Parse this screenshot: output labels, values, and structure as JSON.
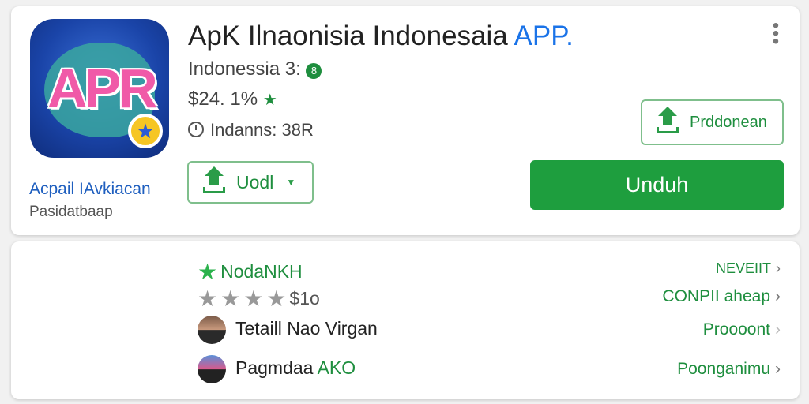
{
  "app": {
    "title_main": "ApK Ilnaonisia Indonesaia",
    "title_accent": "APP.",
    "meta_line1": "Indonessia 3:",
    "meta_line1_badge": "8",
    "meta_line2": "$24. 1%",
    "meta_line3": "Indanns: 38R",
    "icon_text": "APR",
    "icon_badge": "★",
    "developer": "Acpail IAvkiacan",
    "developer_sub": "Pasidatbaap"
  },
  "buttons": {
    "updl": "Uodl",
    "prd": "Prddonean",
    "unduh": "Unduh"
  },
  "rows": [
    {
      "label": "NodaNKH",
      "right": "NEVEIIT"
    },
    {
      "label": "$1o",
      "right": "CONPII aheap"
    },
    {
      "label": "Tetaill Nao Virgan",
      "right": "Proooont"
    },
    {
      "label": "Pagmdaa",
      "label_accent": "AKO",
      "right": "Poonganimu"
    }
  ],
  "icons": {
    "menu": "more-vert-icon",
    "chevron": "›"
  },
  "colors": {
    "primary_green": "#1e9e3e",
    "accent_blue": "#1a73e8"
  }
}
